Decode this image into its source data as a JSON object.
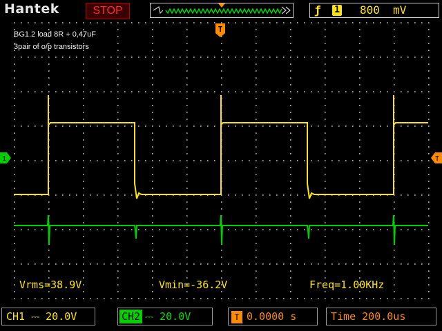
{
  "header": {
    "brand": "Hantek",
    "run_state": "STOP",
    "trigger": {
      "edge_icon": "rising-edge-icon",
      "source": "1",
      "level": "800  mV"
    }
  },
  "notes": [
    "BG1.2 load 8R + 0,47uF",
    "3pair of o/p transistors"
  ],
  "measurements": {
    "vrms": "Vrms=38.9V",
    "vmin": "Vmin=-36.2V",
    "freq": "Freq=1.00KHz"
  },
  "footer": {
    "ch1": {
      "label": "CH1",
      "coupling_icon": "dc-coupling-icon",
      "scale": "20.0V"
    },
    "ch2": {
      "label": "CH2",
      "coupling_icon": "dc-coupling-icon",
      "scale": "20.0V"
    },
    "trigger_position": {
      "marker": "T",
      "value": "0.0000 s"
    },
    "timebase": {
      "label": "Time",
      "value": "200.0us"
    }
  },
  "colors": {
    "ch1": "#ffe600",
    "ch2": "#00d000",
    "trigger": "#ff8c00",
    "grid": "#cfcfcf",
    "stop": "#ff2a2a"
  },
  "waveforms": {
    "ch1": {
      "type": "square",
      "frequency_hz": 1000,
      "time_per_div_us": 200
    },
    "ch2": {
      "type": "flat-with-spikes"
    }
  }
}
